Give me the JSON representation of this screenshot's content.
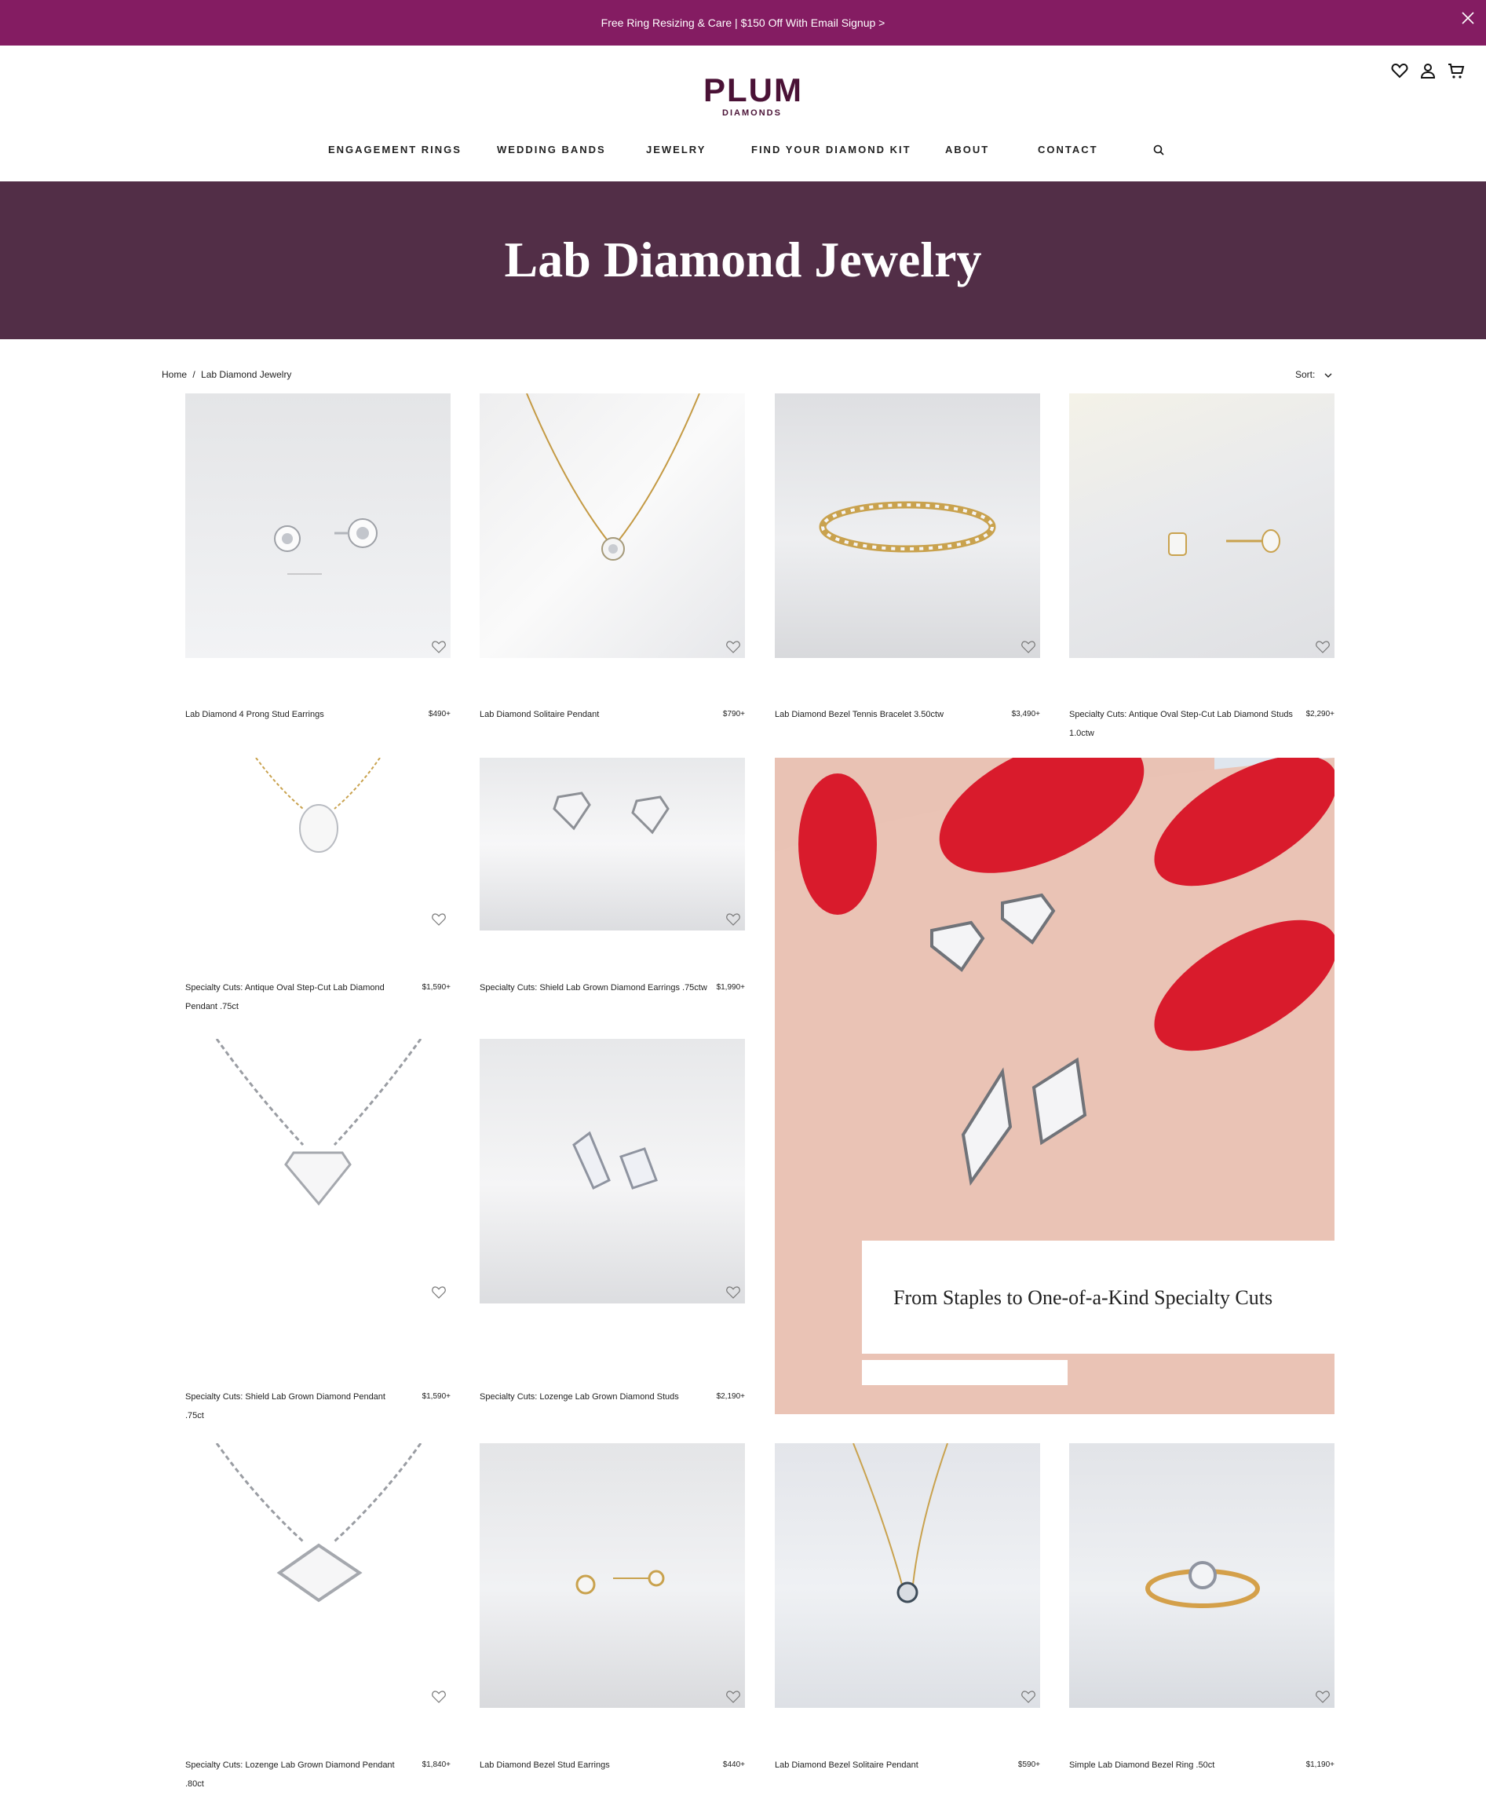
{
  "promo": {
    "text": "Free Ring Resizing & Care | $150 Off With Email Signup >"
  },
  "logo": {
    "main": "PLUM",
    "sub": "DIAMONDS"
  },
  "nav": {
    "items": [
      "ENGAGEMENT RINGS",
      "WEDDING BANDS",
      "JEWELRY",
      "FIND YOUR DIAMOND KIT",
      "ABOUT",
      "CONTACT"
    ]
  },
  "hero": {
    "title": "Lab Diamond Jewelry"
  },
  "breadcrumb": {
    "home": "Home",
    "sep": "/",
    "current": "Lab Diamond Jewelry"
  },
  "sort": {
    "label": "Sort:"
  },
  "products": [
    {
      "name": "Lab Diamond 4 Prong Stud Earrings",
      "price": "$490+"
    },
    {
      "name": "Lab Diamond Solitaire Pendant",
      "price": "$790+"
    },
    {
      "name": "Lab Diamond Bezel Tennis Bracelet 3.50ctw",
      "price": "$3,490+"
    },
    {
      "name": "Specialty Cuts: Antique Oval Step-Cut Lab Diamond Studs 1.0ctw",
      "price": "$2,290+"
    },
    {
      "name": "Specialty Cuts: Antique Oval Step-Cut Lab Diamond Pendant .75ct",
      "price": "$1,590+"
    },
    {
      "name": "Specialty Cuts: Shield Lab Grown Diamond Earrings .75ctw",
      "price": "$1,990+"
    },
    {
      "name": "Specialty Cuts: Shield Lab Grown Diamond Pendant .75ct",
      "price": "$1,590+"
    },
    {
      "name": "Specialty Cuts: Lozenge Lab Grown Diamond Studs",
      "price": "$2,190+"
    },
    {
      "name": "Specialty Cuts: Lozenge Lab Grown Diamond Pendant .80ct",
      "price": "$1,840+"
    },
    {
      "name": "Lab Diamond Bezel Stud Earrings",
      "price": "$440+"
    },
    {
      "name": "Lab Diamond Bezel Solitaire Pendant",
      "price": "$590+"
    },
    {
      "name": "Simple Lab Diamond Bezel Ring .50ct",
      "price": "$1,190+"
    }
  ],
  "feature": {
    "caption": "From Staples to One-of-a-Kind Specialty Cuts"
  },
  "colors": {
    "promo": "#841c62",
    "hero": "#522e47",
    "logo": "#4a1236"
  }
}
